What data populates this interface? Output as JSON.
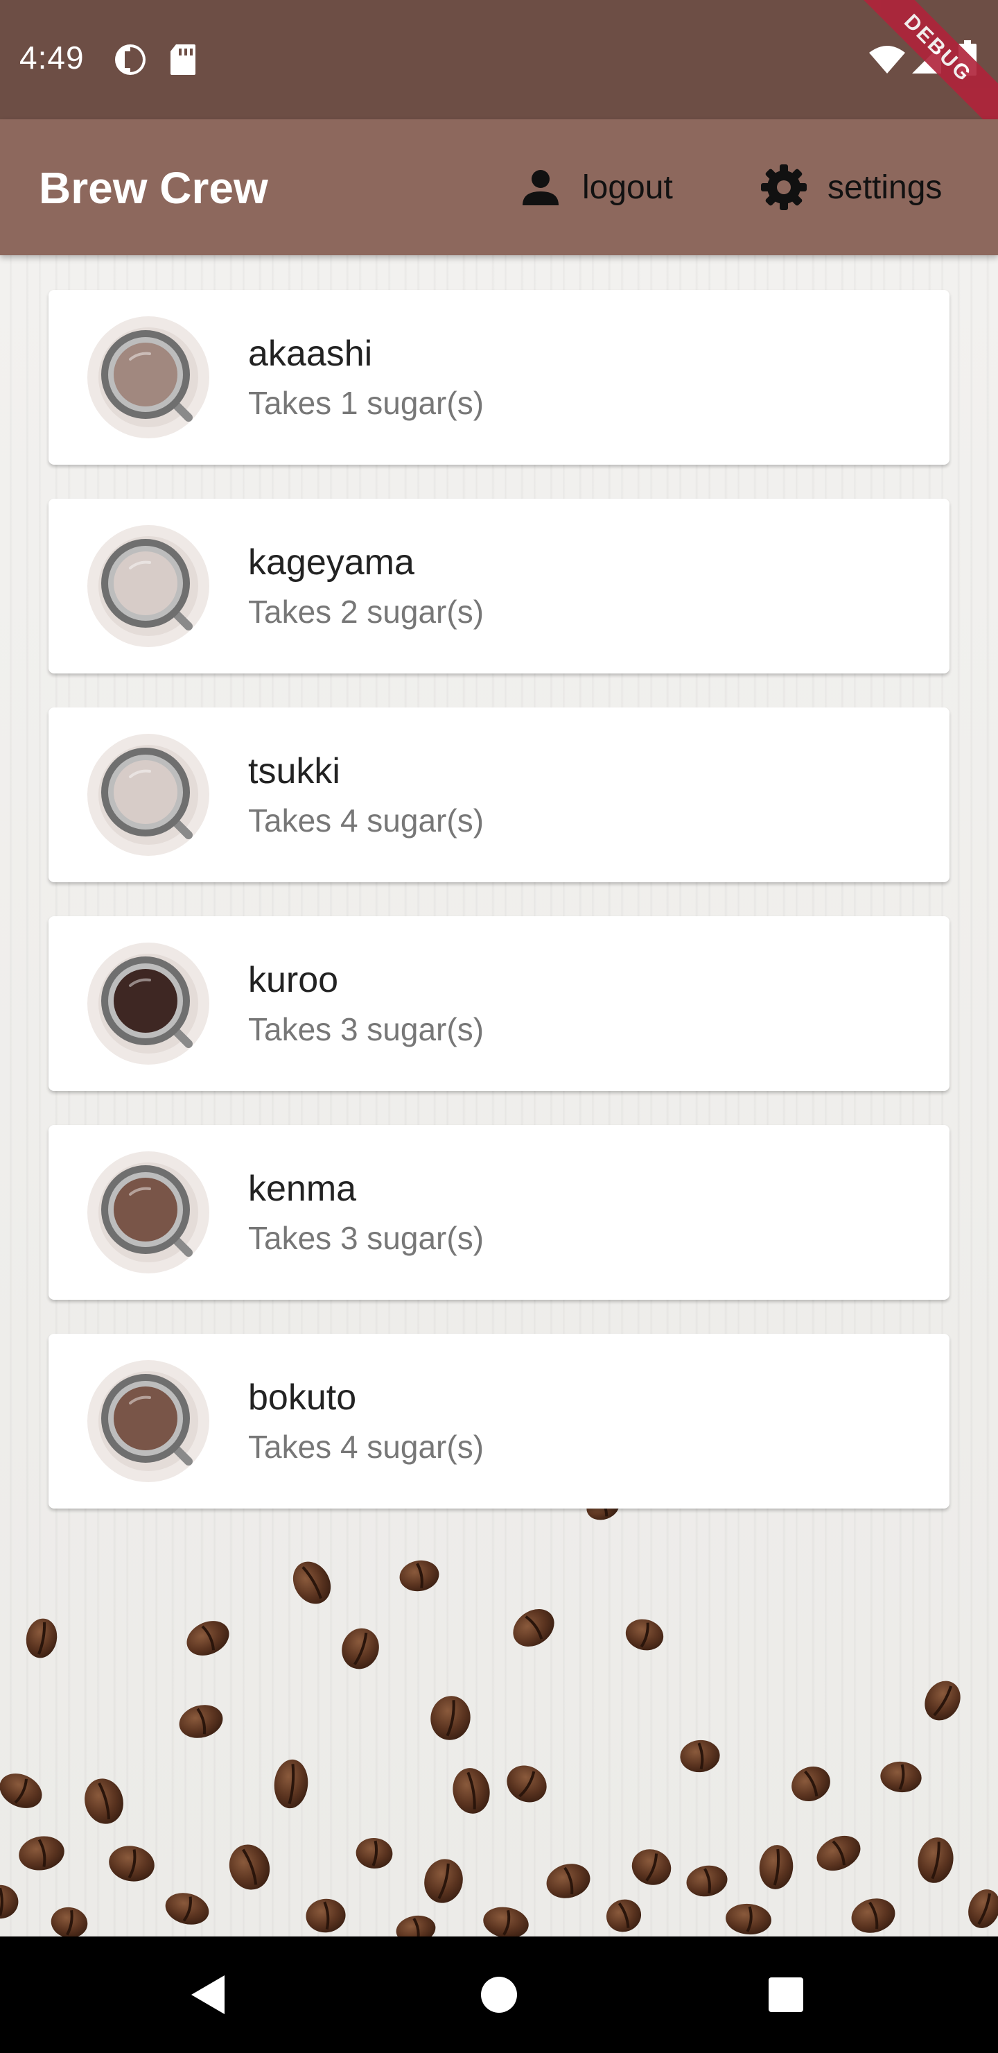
{
  "status_bar": {
    "time": "4:49",
    "debug_label": "DEBUG",
    "icons": [
      "hotspot-icon",
      "sd-card-icon",
      "wifi-icon",
      "signal-icon",
      "battery-icon"
    ]
  },
  "app_bar": {
    "title": "Brew Crew",
    "logout_label": "logout",
    "settings_label": "settings",
    "background_color": "#8d685d",
    "status_color": "#6d4e45"
  },
  "brews": [
    {
      "name": "akaashi",
      "sugars": "Takes 1 sugar(s)",
      "strength_color": "#a1887f"
    },
    {
      "name": "kageyama",
      "sugars": "Takes 2 sugar(s)",
      "strength_color": "#d7ccc8"
    },
    {
      "name": "tsukki",
      "sugars": "Takes 4 sugar(s)",
      "strength_color": "#d7ccc8"
    },
    {
      "name": "kuroo",
      "sugars": "Takes 3 sugar(s)",
      "strength_color": "#3e2723"
    },
    {
      "name": "kenma",
      "sugars": "Takes 3 sugar(s)",
      "strength_color": "#795548"
    },
    {
      "name": "bokuto",
      "sugars": "Takes 4 sugar(s)",
      "strength_color": "#795548"
    }
  ],
  "nav_bar": {
    "icons": [
      "back-icon",
      "home-icon",
      "recents-icon"
    ]
  }
}
